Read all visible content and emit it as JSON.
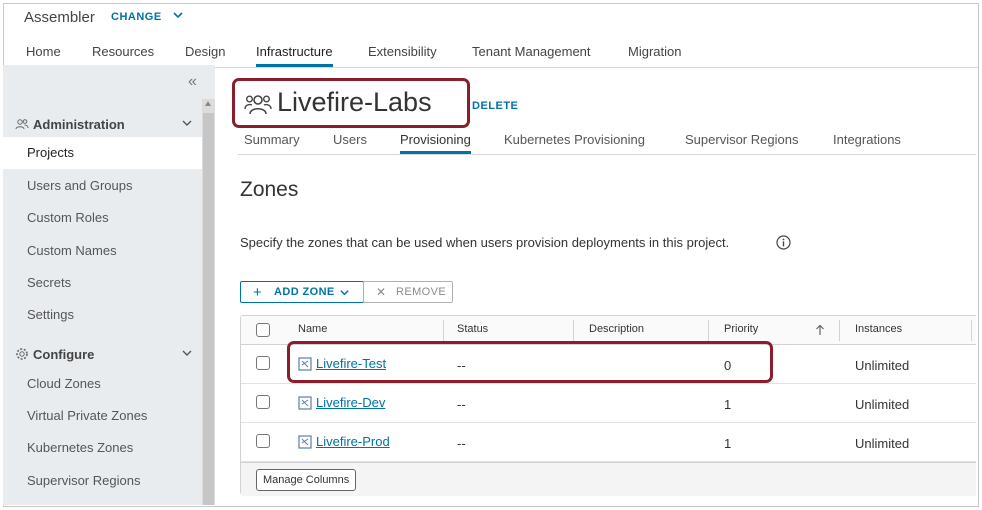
{
  "app": {
    "name": "Assembler",
    "change_label": "CHANGE"
  },
  "top_nav": [
    "Home",
    "Resources",
    "Design",
    "Infrastructure",
    "Extensibility",
    "Tenant Management",
    "Migration"
  ],
  "sidebar": {
    "sections": [
      {
        "label": "Administration",
        "icon": "admin-icon",
        "items": [
          "Projects",
          "Users and Groups",
          "Custom Roles",
          "Custom Names",
          "Secrets",
          "Settings"
        ]
      },
      {
        "label": "Configure",
        "icon": "gear-icon",
        "items": [
          "Cloud Zones",
          "Virtual Private Zones",
          "Kubernetes Zones",
          "Supervisor Regions"
        ]
      }
    ],
    "active_item": "Projects"
  },
  "project": {
    "title": "Livefire-Labs",
    "delete_label": "DELETE"
  },
  "sub_tabs": [
    "Summary",
    "Users",
    "Provisioning",
    "Kubernetes Provisioning",
    "Supervisor Regions",
    "Integrations"
  ],
  "active_sub_tab": "Provisioning",
  "zones": {
    "title": "Zones",
    "description": "Specify the zones that can be used when users provision deployments in this project.",
    "add_label": "ADD ZONE",
    "remove_label": "REMOVE",
    "columns": [
      "Name",
      "Status",
      "Description",
      "Priority",
      "Instances"
    ],
    "rows": [
      {
        "name": "Livefire-Test",
        "status": "--",
        "description": "",
        "priority": "0",
        "instances": "Unlimited"
      },
      {
        "name": "Livefire-Dev",
        "status": "--",
        "description": "",
        "priority": "1",
        "instances": "Unlimited"
      },
      {
        "name": "Livefire-Prod",
        "status": "--",
        "description": "",
        "priority": "1",
        "instances": "Unlimited"
      }
    ],
    "manage_columns_label": "Manage Columns"
  },
  "colors": {
    "accent": "#0072a3",
    "highlight": "#8a1e2c",
    "sidebar_bg": "#e9ecef"
  }
}
